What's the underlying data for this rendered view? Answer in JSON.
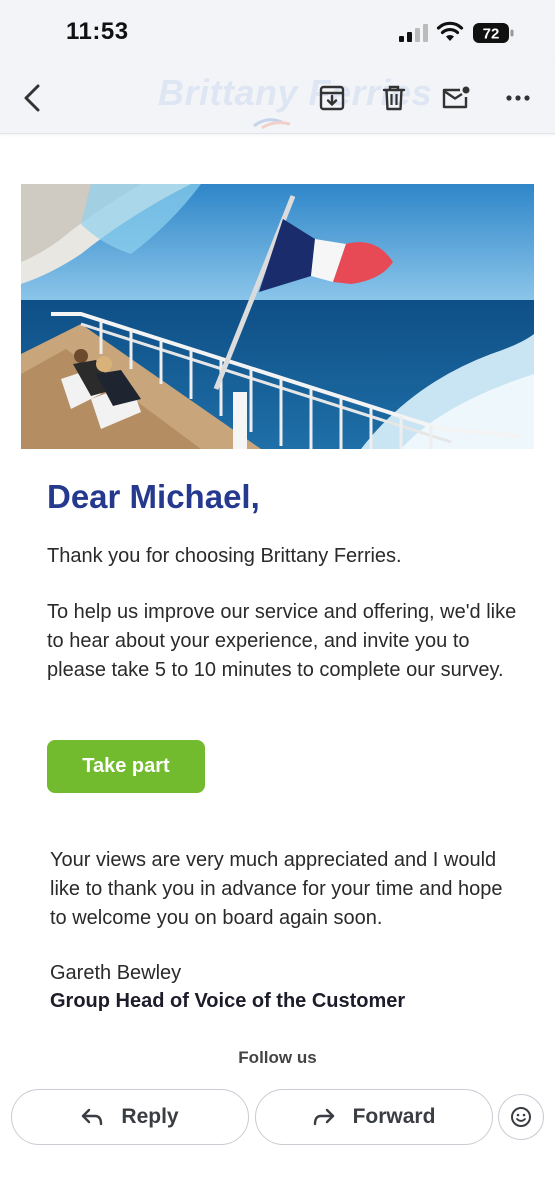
{
  "status_bar": {
    "time": "11:53",
    "battery": "72",
    "icons": [
      "signal-icon",
      "wifi-icon",
      "battery-icon"
    ]
  },
  "app_bar": {
    "watermark_logo": "Brittany Ferries",
    "icons": [
      "back-arrow-icon",
      "archive-icon",
      "delete-icon",
      "mark-unread-icon",
      "more-options-icon"
    ]
  },
  "email": {
    "greeting": "Dear Michael,",
    "paragraph_1": "Thank you for choosing Brittany Ferries.",
    "paragraph_2": "To help us improve our service and offering, we'd like to hear about your experience, and invite you to please take 5 to 10 minutes to complete our survey.",
    "cta_label": "Take part",
    "paragraph_3": "Your views are very much appreciated and I would like to thank you in advance for your time and hope to welcome you on board again soon.",
    "signer_name": "Gareth Bewley",
    "signer_title": "Group Head of Voice of the Customer",
    "follow_label": "Follow us"
  },
  "actions": {
    "reply_label": "Reply",
    "forward_label": "Forward",
    "icons": [
      "reply-icon",
      "forward-icon",
      "emoji-reaction-icon"
    ]
  },
  "colors": {
    "heading": "#253a8e",
    "cta": "#72bb2e",
    "app_bar": "#f2f4f7"
  }
}
